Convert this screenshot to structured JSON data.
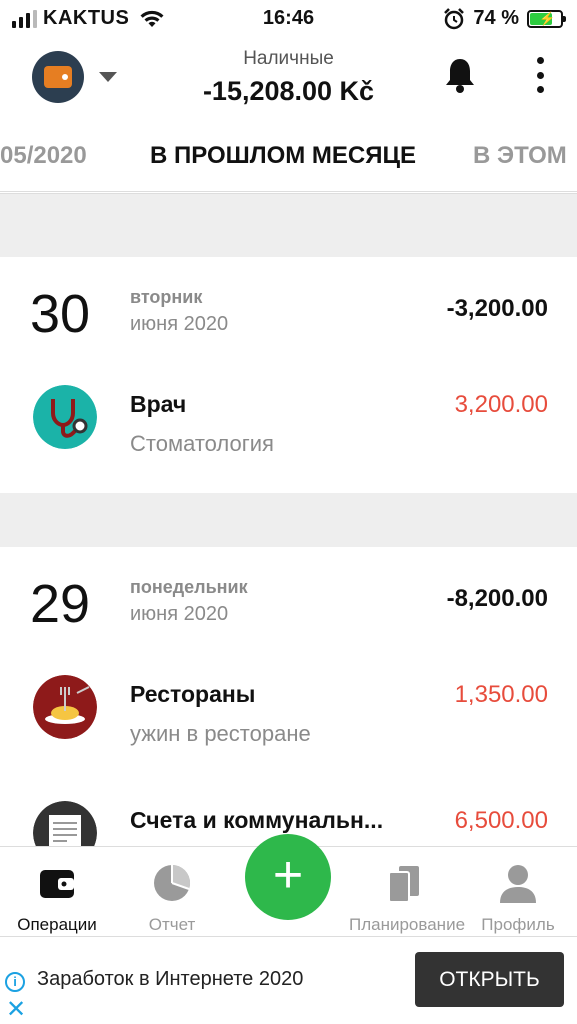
{
  "status_bar": {
    "carrier": "KAKTUS",
    "time": "16:46",
    "battery_percent": "74 %",
    "battery_level": 0.74
  },
  "header": {
    "account_name": "Наличные",
    "account_balance": "-15,208.00 Kč"
  },
  "period_tabs": {
    "previous": "05/2020",
    "current": "В ПРОШЛОМ МЕСЯЦЕ",
    "next": "В ЭТОМ"
  },
  "days": [
    {
      "day": "30",
      "weekday": "вторник",
      "month": "июня 2020",
      "total": "-3,200.00",
      "transactions": [
        {
          "title": "Врач",
          "note": "Стоматология",
          "amount": "3,200.00",
          "icon": "stethoscope-icon",
          "icon_color": "#1bb3a8"
        }
      ]
    },
    {
      "day": "29",
      "weekday": "понедельник",
      "month": "июня 2020",
      "total": "-8,200.00",
      "transactions": [
        {
          "title": "Рестораны",
          "note": "ужин в ресторане",
          "amount": "1,350.00",
          "icon": "pasta-plate-icon",
          "icon_color": "#8e1a1a"
        },
        {
          "title": "Счета и коммунальн...",
          "note": "",
          "amount": "6,500.00",
          "icon": "bill-document-icon",
          "icon_color": "#333333"
        }
      ]
    }
  ],
  "bottom_nav": {
    "operations": "Операции",
    "report": "Отчет",
    "add": "+",
    "planning": "Планирование",
    "profile": "Профиль"
  },
  "ad": {
    "text": "Заработок в Интернете 2020",
    "button": "ОТКРЫТЬ",
    "info": "i",
    "close": "✕"
  },
  "colors": {
    "accent_green": "#2eb84b",
    "expense_red": "#e74c3c",
    "wallet_orange": "#e67e22"
  }
}
